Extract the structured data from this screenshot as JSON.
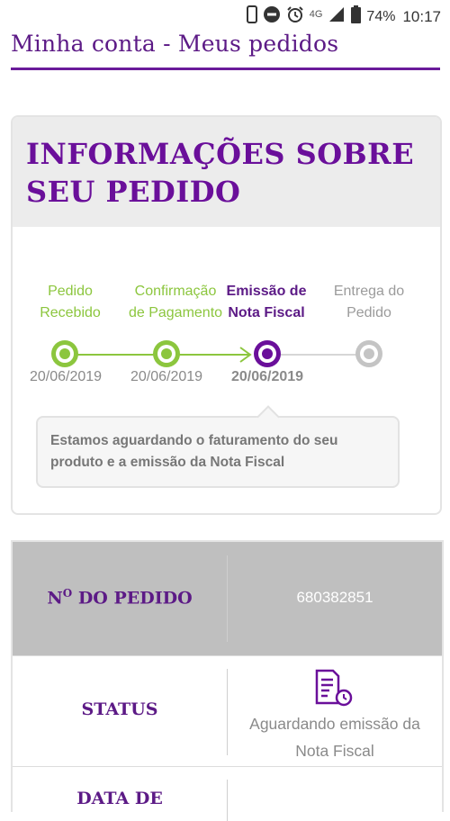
{
  "status_bar": {
    "network": "4G",
    "battery": "74%",
    "time": "10:17"
  },
  "page": {
    "title": "Minha conta - Meus pedidos"
  },
  "order_info": {
    "heading": "INFORMAÇÕES SOBRE SEU PEDIDO",
    "steps": [
      {
        "label_line1": "Pedido",
        "label_line2": "Recebido",
        "date": "20/06/2019",
        "state": "done"
      },
      {
        "label_line1": "Confirmação",
        "label_line2": "de Pagamento",
        "date": "20/06/2019",
        "state": "done"
      },
      {
        "label_line1": "Emissão de",
        "label_line2": "Nota Fiscal",
        "date": "20/06/2019",
        "state": "current"
      },
      {
        "label_line1": "Entrega do",
        "label_line2": "Pedido",
        "date": "",
        "state": "pending"
      }
    ],
    "message": "Estamos aguardando o faturamento do seu produto e a emissão da Nota Fiscal"
  },
  "details": {
    "order_number_label": "Nº DO PEDIDO",
    "order_number_label_prefix": "N",
    "order_number_label_sup": "O",
    "order_number_label_rest": " DO PEDIDO",
    "order_number_value": "680382851",
    "status_label": "STATUS",
    "status_value_line1": "Aguardando emissão da",
    "status_value_line2": "Nota Fiscal",
    "status_icon": "invoice-clock-icon",
    "date_label": "DATA DE"
  },
  "colors": {
    "brand_purple": "#6a0f9a",
    "done_green": "#8cc63e",
    "pending_gray": "#c4c4c4"
  }
}
